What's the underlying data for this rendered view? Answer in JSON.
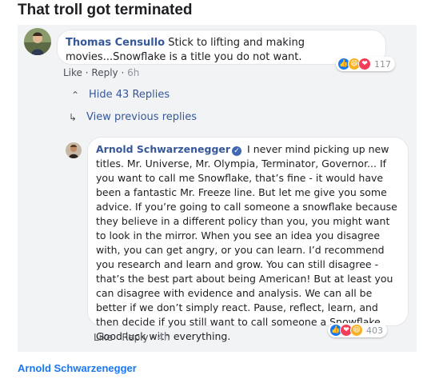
{
  "post": {
    "title": "That troll got terminated"
  },
  "comment_1": {
    "author": "Thomas Censullo",
    "text": "Stick to lifting and making movies...Snowflake is a title you do not want.",
    "reaction_count": "117",
    "reactions": [
      "like-icon",
      "haha-icon",
      "love-icon"
    ],
    "like_label": "Like",
    "reply_label": "Reply",
    "age": "6h"
  },
  "replies": {
    "hide_label": "Hide 43 Replies",
    "previous_label": "View previous replies"
  },
  "comment_2": {
    "author": "Arnold Schwarzenegger",
    "text": "I never mind picking up new titles. Mr. Universe, Mr. Olympia, Terminator, Governor... If you want to call me Snowflake, that’s fine - it would have been a fantastic Mr. Freeze line. But let me give you some advice. If you’re going to call someone a snowflake because they believe in a different policy than you, you might want to look in the mirror. When you see an idea you disagree with, you can get angry, or you can learn. I’d recommend you research and learn and grow. You can still disagree - that’s the best part about being American! But at least you can disagree with evidence and analysis. We can all be better if we don’t simply react. Pause, reflect, learn, and then decide if you still want to call someone a Snowflake. Good luck with everything.",
    "reaction_count": "403",
    "reactions": [
      "like-icon",
      "love-icon",
      "haha-icon"
    ],
    "like_label": "Like",
    "reply_label": "Reply",
    "age": "4h"
  },
  "footer": {
    "credit": "Arnold Schwarzenegger"
  },
  "colors": {
    "link": "#365899",
    "footer_link": "#1877f2",
    "thread_bg": "#f2f3f5",
    "meta": "#90949c"
  }
}
